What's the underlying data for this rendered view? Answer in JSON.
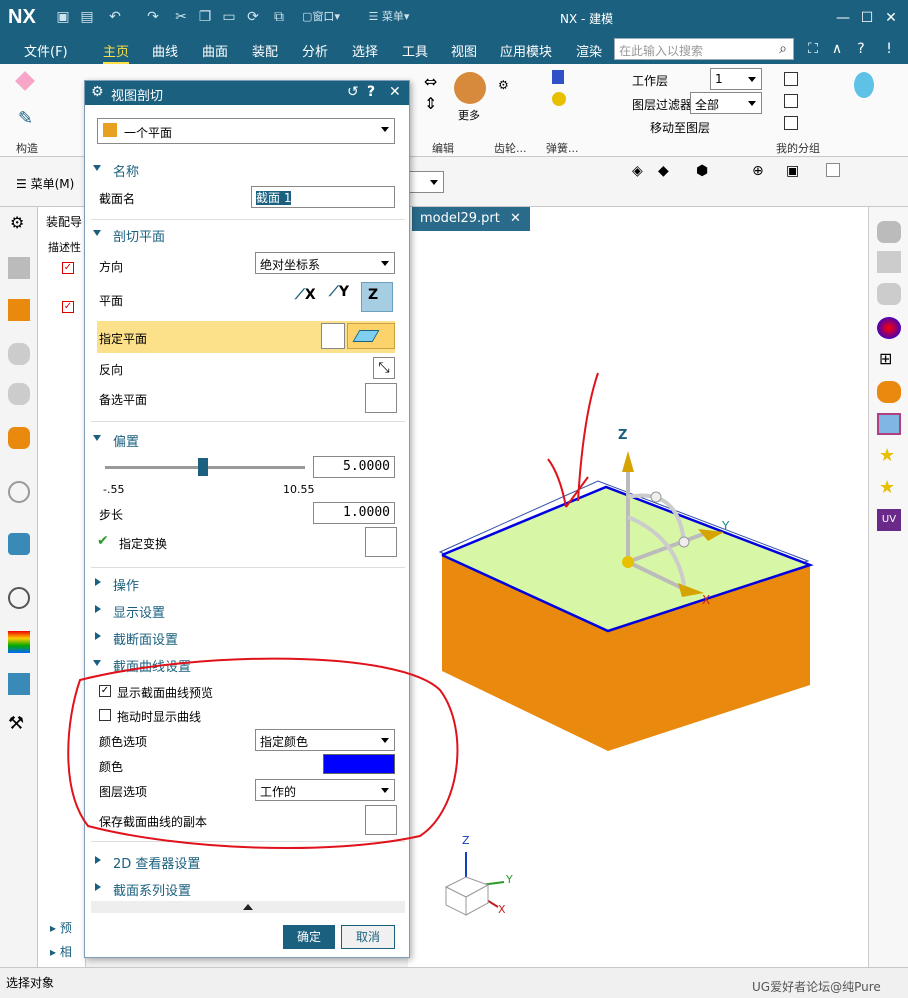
{
  "app": {
    "logo": "NX",
    "window_title": "NX - 建模",
    "window_menu": "窗口",
    "menu_label": "菜单"
  },
  "menubar": {
    "items": [
      "文件(F)",
      "主页",
      "曲线",
      "曲面",
      "装配",
      "分析",
      "选择",
      "工具",
      "视图",
      "应用模块",
      "渲染"
    ],
    "active": "主页",
    "search_placeholder": "在此输入以搜索"
  },
  "ribbon": {
    "groups": [
      "构造",
      "编辑",
      "齿轮...",
      "弹簧...",
      "我的分组"
    ],
    "more_label": "更多",
    "work_layer_label": "工作层",
    "work_layer_value": "1",
    "layer_filter_label": "图层过滤器",
    "layer_filter_value": "全部",
    "move_to_layer_label": "移动至图层"
  },
  "toolbar2": {
    "menu_label": "菜单(M)"
  },
  "navigator": {
    "title": "装配导",
    "column": "描述性",
    "bottom_items": [
      "预",
      "相"
    ]
  },
  "graphics": {
    "tab_label": "model29.prt",
    "axis_z": "Z",
    "axis_y": "Y",
    "axis_x": "X",
    "colors": {
      "top_face": "#d7f7a6",
      "body": "#e98a0f",
      "section_curve": "#0000e0",
      "annotation": "#e0121b"
    }
  },
  "dialog": {
    "title": "视图剖切",
    "type_value": "一个平面",
    "sections": {
      "name": "名称",
      "cut_plane": "剖切平面",
      "offset": "偏置",
      "operation": "操作",
      "display": "显示设置",
      "section_face": "截断面设置",
      "section_curve": "截面曲线设置",
      "viewer2d": "2D 查看器设置",
      "series": "截面系列设置"
    },
    "name_label": "截面名",
    "name_value": "截面 1",
    "orientation_label": "方向",
    "orientation_value": "绝对坐标系",
    "plane_label": "平面",
    "plane_buttons": [
      "X",
      "Y",
      "Z"
    ],
    "specify_plane_label": "指定平面",
    "reverse_label": "反向",
    "alt_plane_label": "备选平面",
    "slider_min": "-.55",
    "slider_max": "10.55",
    "slider_position": 0.49,
    "offset_value": "5.0000",
    "step_label": "步长",
    "step_value": "1.0000",
    "specify_transform_label": "指定变换",
    "show_preview_label": "显示截面曲线预览",
    "show_preview_checked": true,
    "show_on_drag_label": "拖动时显示曲线",
    "show_on_drag_checked": false,
    "color_option_label": "颜色选项",
    "color_option_value": "指定颜色",
    "color_label": "颜色",
    "color_value": "#0000ff",
    "layer_option_label": "图层选项",
    "layer_option_value": "工作的",
    "save_copy_label": "保存截面曲线的副本",
    "ok_label": "确定",
    "cancel_label": "取消"
  },
  "status": {
    "prompt": "选择对象",
    "watermark": "UG爱好者论坛@纯Pure"
  }
}
